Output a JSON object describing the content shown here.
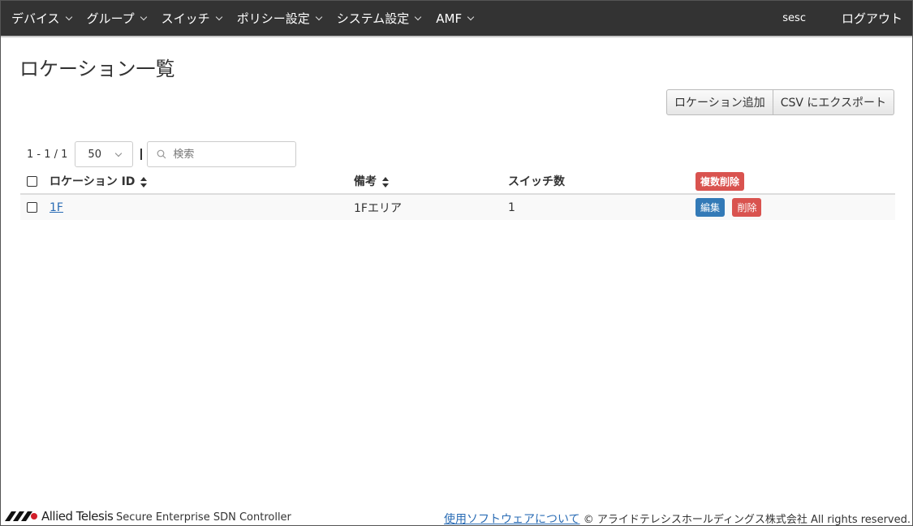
{
  "nav": {
    "items": [
      {
        "label": "デバイス"
      },
      {
        "label": "グループ"
      },
      {
        "label": "スイッチ"
      },
      {
        "label": "ポリシー設定"
      },
      {
        "label": "システム設定"
      },
      {
        "label": "AMF"
      }
    ],
    "user": "sesc",
    "logout": "ログアウト"
  },
  "page": {
    "title": "ロケーション一覧",
    "add_button": "ロケーション追加",
    "export_button": "CSV にエクスポート"
  },
  "toolbar": {
    "pager_text": "1 - 1 / 1",
    "page_size": "50",
    "search_placeholder": "検索"
  },
  "table": {
    "headers": {
      "id": "ロケーション ID",
      "note": "備考",
      "count": "スイッチ数",
      "bulk_delete": "複数削除"
    },
    "rows": [
      {
        "id": "1F",
        "note": "1Fエリア",
        "count": "1",
        "edit": "編集",
        "delete": "削除"
      }
    ]
  },
  "footer": {
    "brand": "Allied Telesis",
    "product": "Secure Enterprise SDN Controller",
    "software_link": "使用ソフトウェアについて",
    "copyright": "© アライドテレシスホールディングス株式会社 All rights reserved."
  },
  "colors": {
    "navbar": "#333333",
    "danger": "#d9534f",
    "primary": "#337ab7",
    "link": "#2a6cb5"
  }
}
